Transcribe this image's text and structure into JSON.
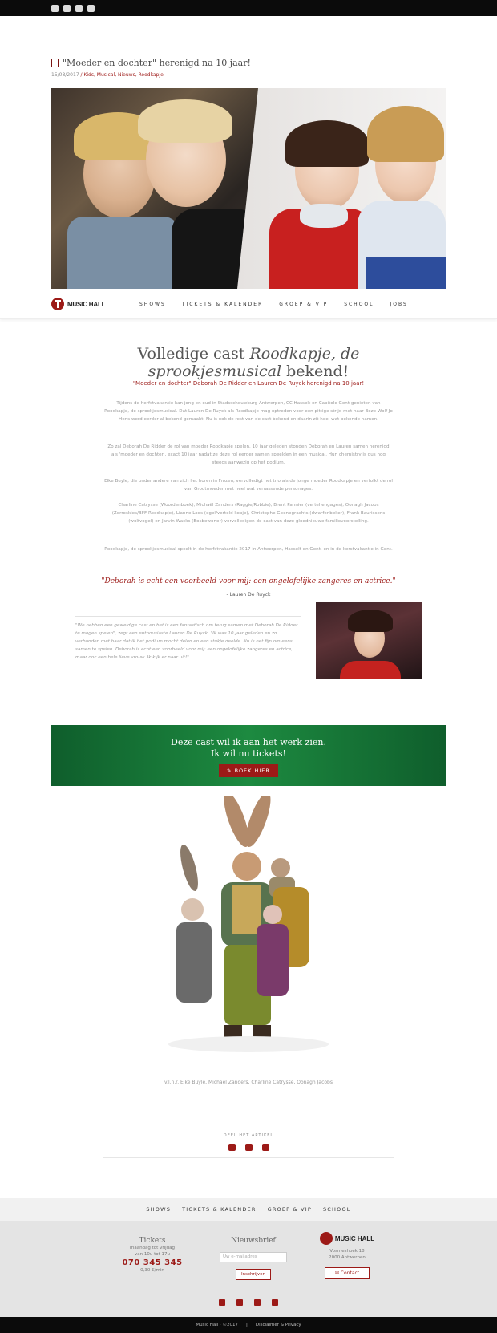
{
  "top_social": [
    "facebook-icon",
    "twitter-icon",
    "instagram-icon",
    "youtube-icon"
  ],
  "article": {
    "title": "\"Moeder en dochter\" herenigd na 10 jaar!",
    "date": "15/08/2017",
    "categories": "Kids, Musical, Nieuws, Roodkapje"
  },
  "nav": {
    "logo": "MUSIC HALL",
    "items": [
      "SHOWS",
      "TICKETS & KALENDER",
      "GROEP & VIP",
      "SCHOOL",
      "JOBS"
    ]
  },
  "headline": {
    "part1": "Volledige cast ",
    "part2": "Roodkapje, de sprookjesmusical",
    "part3": " bekend!",
    "sub": "\"Moeder en dochter\" Deborah De Ridder en Lauren De Ruyck herenigd na 10 jaar!"
  },
  "paragraphs": [
    "Tijdens de herfstvakantie kan jong en oud in Stadsschouwburg Antwerpen, CC Hasselt en Capitole Gent genieten van Roodkapje, de sprookjesmusical. Dat Lauren De Ruyck als Roodkapje mag optreden voor een pittige strijd met haar Boze Wolf Jo Hens werd eerder al bekend gemaakt. Nu is ook de rest van de cast bekend en daarin zit heel wat bekende namen.",
    "Zo zal Deborah De Ridder de rol van moeder Roodkapje spelen. 10 jaar geleden stonden Deborah en Lauren samen herenigd als 'moeder en dochter', exact 10 jaar nadat ze deze rol eerder samen speelden in een musical. Hun chemistry is dus nog steeds aanwezig op het podium.",
    "Elke Buyle, die onder andere van zich liet horen in Frozen, vervolledigt het trio als de jonge moeder Roodkapje en vertolkt de rol van Grootmoeder met heel wat verrassende personages.",
    "Charline Catrysse (Woordenboek), Michaël Zanders (Raggie/Robbie), Brent Pannier (vertel engages), Oonagh Jacobs (Zorroskies/BFF Roodkapje), Lianne Loos (egel/verteld kopje), Christophe Goenegrachts (dwarfenbeker), Frank Baurissens (wolfvogel) en Jarvin Wacks (Bosbewoner) vervolledigen de cast van deze gloednieuwe familievoorstelling.",
    "Roodkapje, de sprookjesmusical speelt in de herfstvakantie 2017 in Antwerpen, Hasselt en Gent, en in de kerstvakantie in Gent."
  ],
  "quote": {
    "text": "\"Deborah is echt een voorbeeld voor mij: een ongelofelijke zangeres en actrice.\"",
    "author": "- Lauren De Ruyck"
  },
  "sidebox": "\"We hebben een geweldige cast en het is een fantastisch om terug samen met Deborah De Ridder te mogen spelen\", zegt een enthousiaste Lauren De Ruyck. \"Ik was 10 jaar geleden en zo verbonden met haar dat ik het podium mocht delen en een stukje deelde. Nu is het fijn om eens samen te spelen. Deborah is echt een voorbeeld voor mij: een ongelofelijke zangeres en actrice, maar ook een hele lieve vrouw. Ik kijk er naar uit!\"",
  "cta": {
    "line1": "Deze cast wil ik aan het werk zien.",
    "line2": "Ik wil nu tickets!",
    "button": "BOEK HIER"
  },
  "caption": "v.l.n.r. Elke Buyle, Michaël Zanders, Charline Catrysse, Oonagh Jacobs",
  "share": {
    "label": "DEEL HET ARTIKEL",
    "icons": [
      "facebook-icon",
      "linkedin-icon",
      "mail-icon"
    ]
  },
  "footer_nav": [
    "SHOWS",
    "TICKETS & KALENDER",
    "GROEP & VIP",
    "SCHOOL"
  ],
  "footer": {
    "tickets_title": "Tickets",
    "tickets_hours": "maandag tot vrijdag",
    "tickets_hours2": "van 10u tot 17u",
    "phone": "070 345 345",
    "phone_note": "0,30 €/min",
    "newsletter_title": "Nieuwsbrief",
    "newsletter_placeholder": "Uw e-mailadres",
    "newsletter_button": "Inschrijven",
    "logo": "MUSIC HALL",
    "address1": "Vosmeshoek 18",
    "address2": "2000 Antwerpen",
    "contact_button": "Contact"
  },
  "footer_social": [
    "facebook-icon",
    "twitter-icon",
    "instagram-icon",
    "youtube-icon"
  ],
  "bottom": {
    "copyright": "Music Hall · ©2017",
    "sep": "|",
    "links": "Disclaimer & Privacy"
  }
}
